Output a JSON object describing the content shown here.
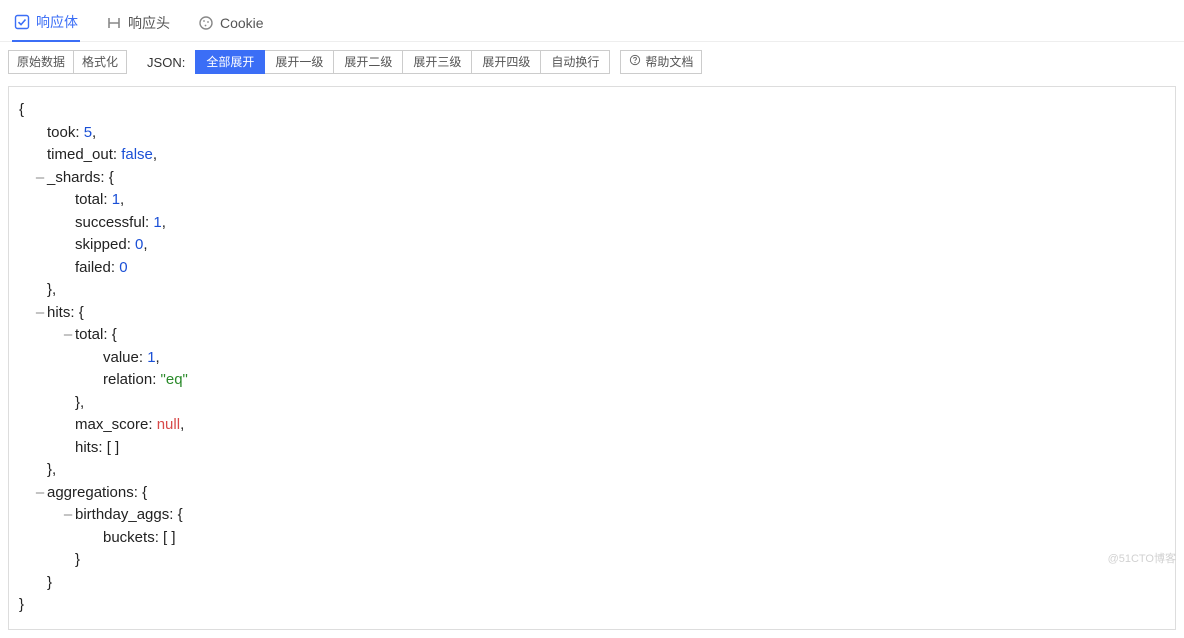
{
  "tabs": {
    "response_body": "响应体",
    "response_headers": "响应头",
    "cookie": "Cookie"
  },
  "toolbar": {
    "raw": "原始数据",
    "formatted": "格式化",
    "json_label": "JSON:",
    "expand_all": "全部展开",
    "expand_l1": "展开一级",
    "expand_l2": "展开二级",
    "expand_l3": "展开三级",
    "expand_l4": "展开四级",
    "wrap": "自动换行",
    "help": "帮助文档"
  },
  "json": {
    "open_brace": "{",
    "close_brace": "}",
    "open_bracket": "[ ]",
    "took_key": "took",
    "took_val": "5",
    "timed_out_key": "timed_out",
    "timed_out_val": "false",
    "shards_key": "_shards",
    "shards_total_key": "total",
    "shards_total_val": "1",
    "shards_successful_key": "successful",
    "shards_successful_val": "1",
    "shards_skipped_key": "skipped",
    "shards_skipped_val": "0",
    "shards_failed_key": "failed",
    "shards_failed_val": "0",
    "hits_key": "hits",
    "hits_total_key": "total",
    "hits_total_value_key": "value",
    "hits_total_value_val": "1",
    "hits_total_relation_key": "relation",
    "hits_total_relation_val": "\"eq\"",
    "hits_max_score_key": "max_score",
    "hits_max_score_val": "null",
    "hits_hits_key": "hits",
    "aggs_key": "aggregations",
    "aggs_birthday_key": "birthday_aggs",
    "aggs_buckets_key": "buckets",
    "toggle": "–"
  },
  "watermark": "@51CTO博客"
}
